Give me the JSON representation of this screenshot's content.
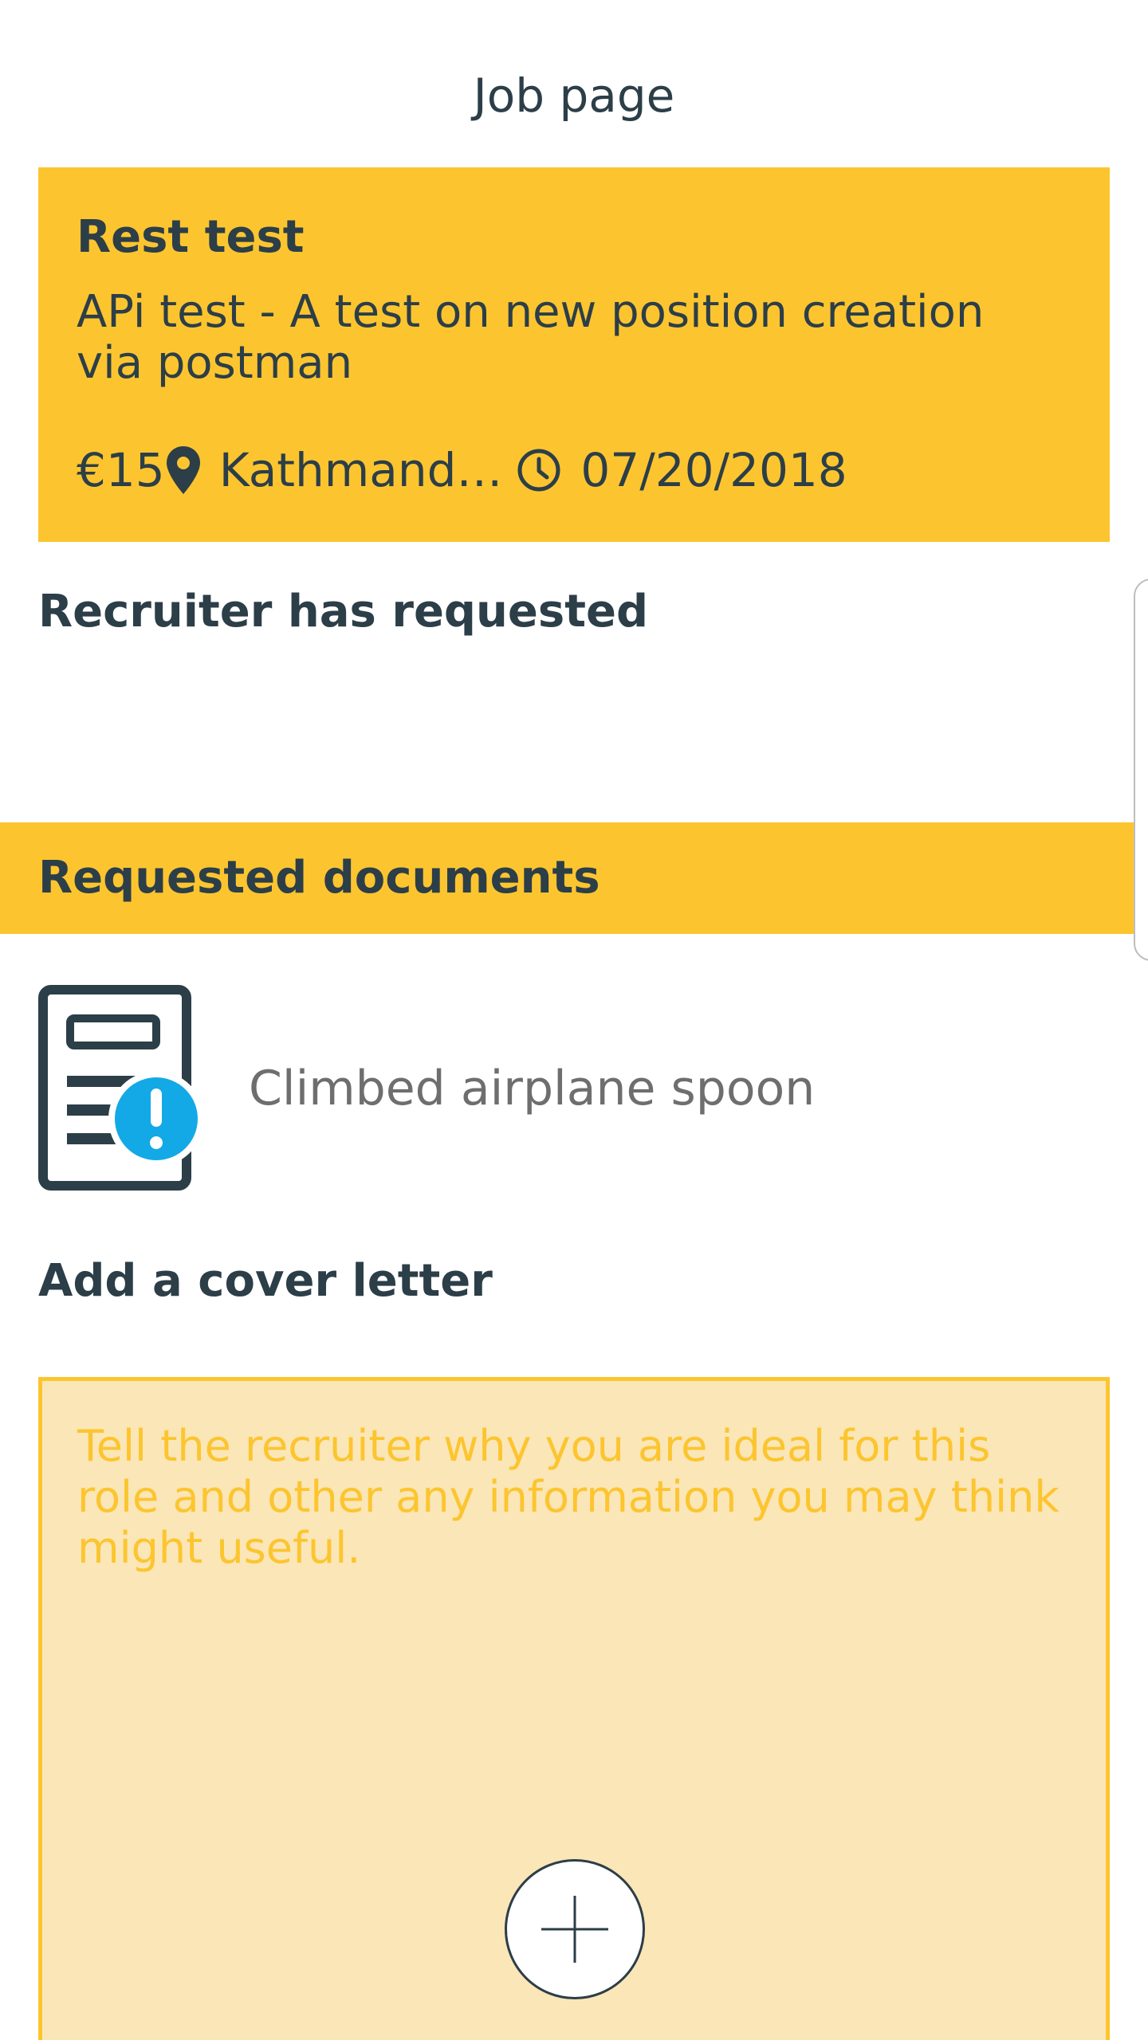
{
  "header": {
    "title": "Job page"
  },
  "job": {
    "title": "Rest test",
    "description": "APi test - A test on new position creation via postman",
    "salary": "€15",
    "location": "Kathmand…",
    "date": "07/20/2018",
    "icons": {
      "location": "location-pin-icon",
      "date": "clock-icon"
    }
  },
  "recruiter_section": {
    "heading": "Recruiter has requested"
  },
  "documents_section": {
    "heading": "Requested documents",
    "items": [
      {
        "name": "Climbed airplane spoon",
        "icon": "document-alert-icon"
      }
    ]
  },
  "cover_letter": {
    "heading": "Add a cover letter",
    "placeholder": "Tell the recruiter why you are ideal for this role and other any information you may think might useful.",
    "add_icon": "plus-icon"
  },
  "colors": {
    "accent": "#fcc52f",
    "text_dark": "#2c3e48",
    "cover_bg": "#fbe6b7",
    "alert_blue": "#13a9e6",
    "muted_text": "#6e6e6e"
  }
}
